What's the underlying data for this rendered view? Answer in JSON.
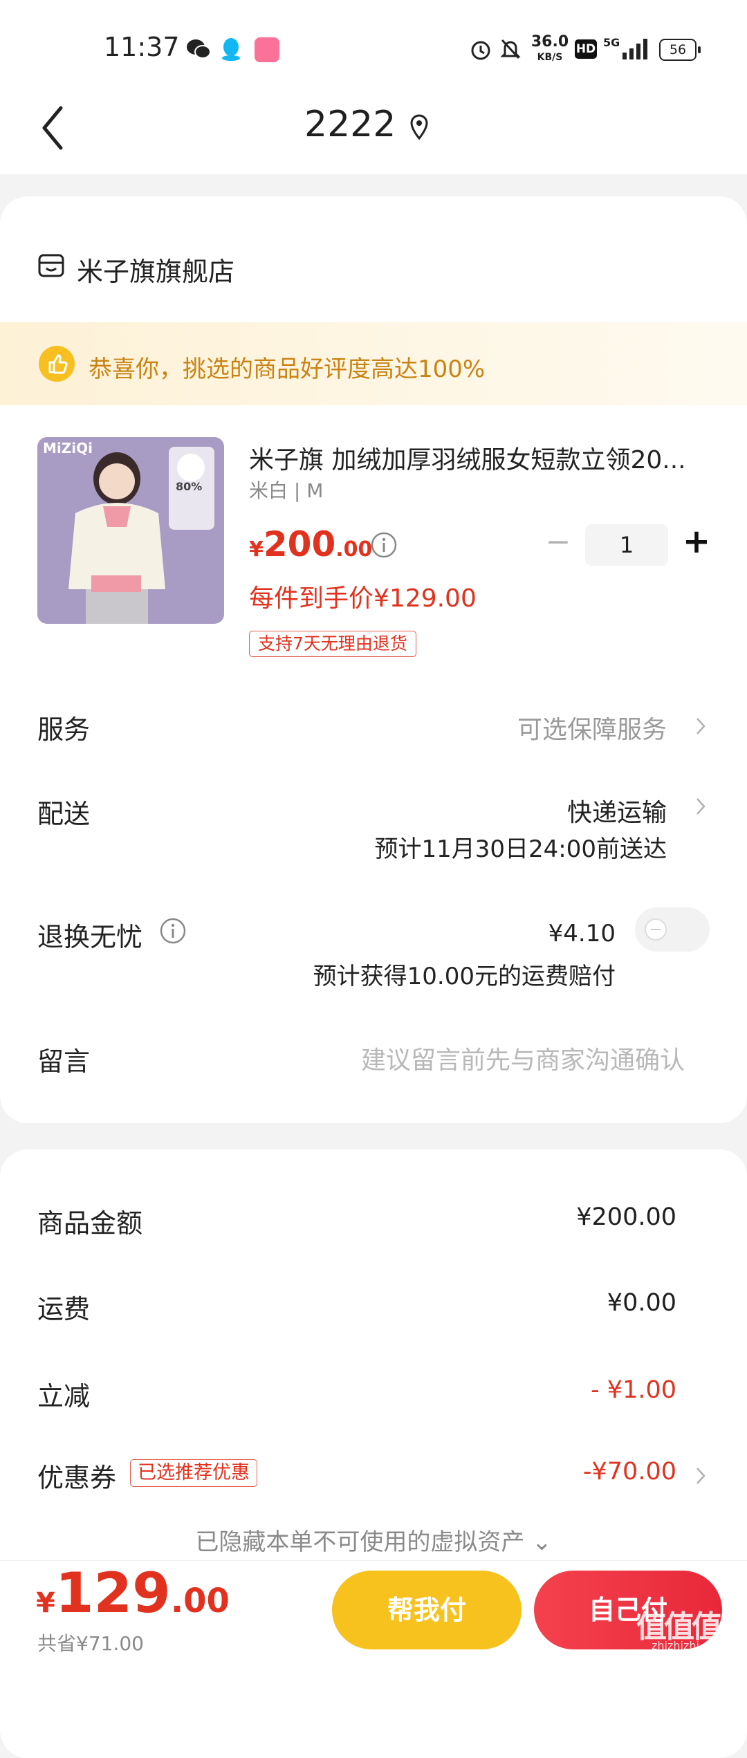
{
  "status_bar": {
    "time": "11:37",
    "speed_value": "36.0",
    "speed_unit": "KB/S",
    "hd": "HD",
    "network": "5G",
    "battery": "56"
  },
  "header": {
    "title": "2222"
  },
  "store": {
    "name": "米子旗旗舰店"
  },
  "promo": {
    "text": "恭喜你，挑选的商品好评度高达100%"
  },
  "product": {
    "title": "米子旗 加绒加厚羽绒服女短款立领20...",
    "spec": "米白 | M",
    "price_currency": "¥",
    "price_int": "200",
    "price_dec": ".00",
    "final_price": "每件到手价¥129.00",
    "return_badge": "支持7天无理由退货",
    "image_brand": "MiZiQi",
    "image_tag": "80%",
    "quantity": "1",
    "minus": "−",
    "plus": "+"
  },
  "rows": {
    "services_label": "服务",
    "services_value": "可选保障服务",
    "delivery_label": "配送",
    "delivery_value": "快递运输",
    "delivery_eta": "预计11月30日24:00前送达",
    "worry_label": "退换无忧",
    "worry_price": "¥4.10",
    "worry_note": "预计获得10.00元的运费赔付",
    "message_label": "留言",
    "message_placeholder": "建议留言前先与商家沟通确认"
  },
  "summary": {
    "goods_label": "商品金额",
    "goods_value": "¥200.00",
    "shipping_label": "运费",
    "shipping_value": "¥0.00",
    "discount_label": "立减",
    "discount_value": "- ¥1.00",
    "coupon_label": "优惠券",
    "coupon_badge": "已选推荐优惠",
    "coupon_value": "-¥70.00",
    "hidden_assets": "已隐藏本单不可使用的虚拟资产 ⌄"
  },
  "bottom": {
    "total_currency": "¥",
    "total_int": "129",
    "total_dec": ".00",
    "saved": "共省¥71.00",
    "help_pay": "帮我付",
    "self_pay": "自己付",
    "watermark": "值值值",
    "watermark_sub": "zhizhizhi.com"
  },
  "colors": {
    "accent_red": "#e0321e",
    "help_pay_yellow": "#f8c21e",
    "self_pay_red": "#ef3344",
    "promo_text": "#c98312"
  }
}
